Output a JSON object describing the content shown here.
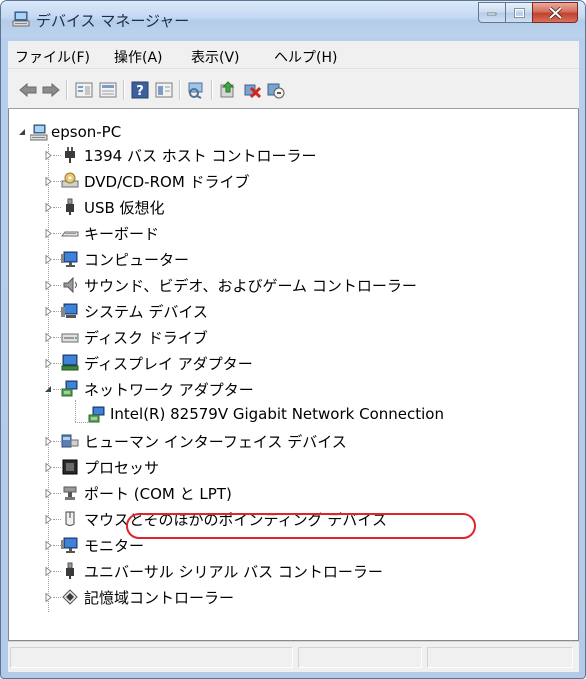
{
  "window": {
    "title": "デバイス マネージャー",
    "accent_close": "#c0422f"
  },
  "menu": [
    {
      "label": "ファイル(F)"
    },
    {
      "label": "操作(A)"
    },
    {
      "label": "表示(V)"
    },
    {
      "label": "ヘルプ(H)"
    }
  ],
  "toolbar": {
    "buttons": [
      "back-icon",
      "forward-icon",
      "properties-icon",
      "show-icon",
      "help-icon",
      "view-icon",
      "scan-icon",
      "update-driver-icon",
      "uninstall-icon",
      "disable-icon"
    ]
  },
  "tree": {
    "root": {
      "label": "epson-PC",
      "icon": "computer-icon"
    },
    "items": [
      {
        "label": "1394 バス ホスト コントローラー",
        "icon": "plug-icon"
      },
      {
        "label": "DVD/CD-ROM ドライブ",
        "icon": "disc-drive-icon"
      },
      {
        "label": "USB 仮想化",
        "icon": "usb-icon"
      },
      {
        "label": "キーボード",
        "icon": "keyboard-icon"
      },
      {
        "label": "コンピューター",
        "icon": "monitor-icon"
      },
      {
        "label": "サウンド、ビデオ、およびゲーム コントローラー",
        "icon": "speaker-icon"
      },
      {
        "label": "システム デバイス",
        "icon": "system-icon"
      },
      {
        "label": "ディスク ドライブ",
        "icon": "disk-icon"
      },
      {
        "label": "ディスプレイ アダプター",
        "icon": "display-adapter-icon"
      },
      {
        "label": "ネットワーク アダプター",
        "icon": "network-icon"
      },
      {
        "label": "Intel(R) 82579V Gigabit Network Connection",
        "icon": "network-card-icon"
      },
      {
        "label": "ヒューマン インターフェイス デバイス",
        "icon": "hid-icon"
      },
      {
        "label": "プロセッサ",
        "icon": "processor-icon"
      },
      {
        "label": "ポート (COM と LPT)",
        "icon": "port-icon"
      },
      {
        "label": "マウスとそのほかのポインティング デバイス",
        "icon": "mouse-icon"
      },
      {
        "label": "モニター",
        "icon": "monitor-icon"
      },
      {
        "label": "ユニバーサル シリアル バス コントローラー",
        "icon": "usb-icon"
      },
      {
        "label": "記憶域コントローラー",
        "icon": "storage-icon"
      }
    ]
  }
}
